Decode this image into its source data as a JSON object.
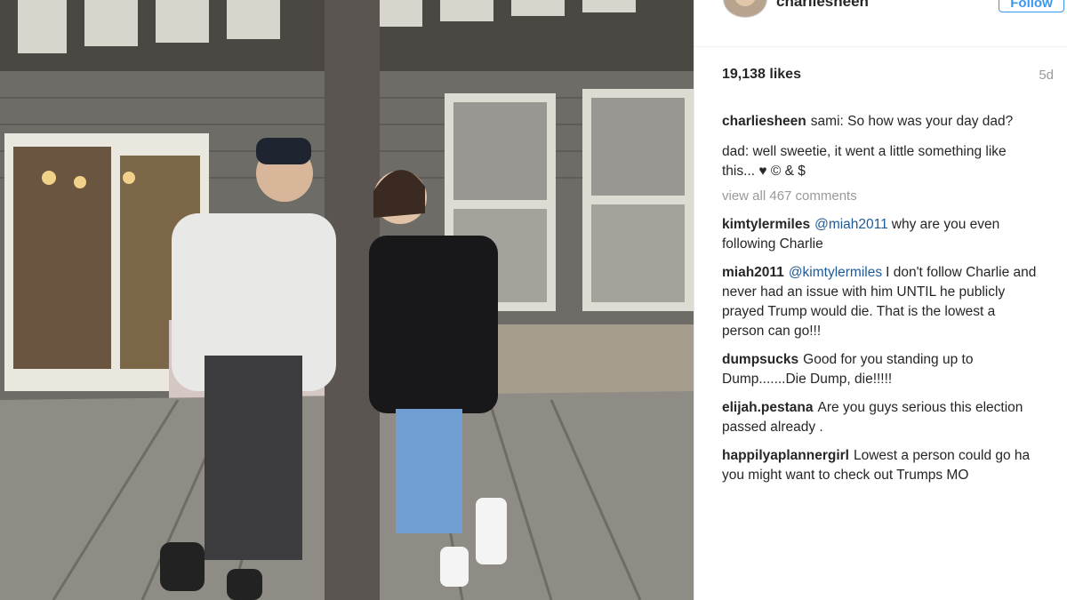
{
  "post": {
    "username": "charliesheen",
    "follow_label": "Follow",
    "likes": "19,138 likes",
    "age": "5d",
    "caption": {
      "username": "charliesheen",
      "line1": "sami: So how was your day dad?",
      "line2": "dad: well sweetie, it went  a little something like  this... ♥ © & $"
    },
    "view_all": "view all 467 comments",
    "comments": [
      {
        "username": "kimtylermiles",
        "mention": "@miah2011",
        "text": "why are you even following Charlie"
      },
      {
        "username": "miah2011",
        "mention": "@kimtylermiles",
        "text": "I don't follow Charlie and never had an issue with him UNTIL he publicly prayed Trump would die. That is the lowest a person can go!!!"
      },
      {
        "username": "dumpsucks",
        "mention": "",
        "text": "Good for you standing up to Dump.......Die Dump, die!!!!!"
      },
      {
        "username": "elijah.pestana",
        "mention": "",
        "text": "Are you guys serious this election passed already ."
      },
      {
        "username": "happilyaplannergirl",
        "mention": "",
        "text": "Lowest a person could go ha you might want to check out Trumps MO"
      }
    ]
  },
  "icons": {
    "avatar": "profile-avatar",
    "photo": "post-photo"
  },
  "colors": {
    "link": "#3897f0",
    "mention": "#1f5a96",
    "muted": "#999999",
    "text": "#262626"
  }
}
